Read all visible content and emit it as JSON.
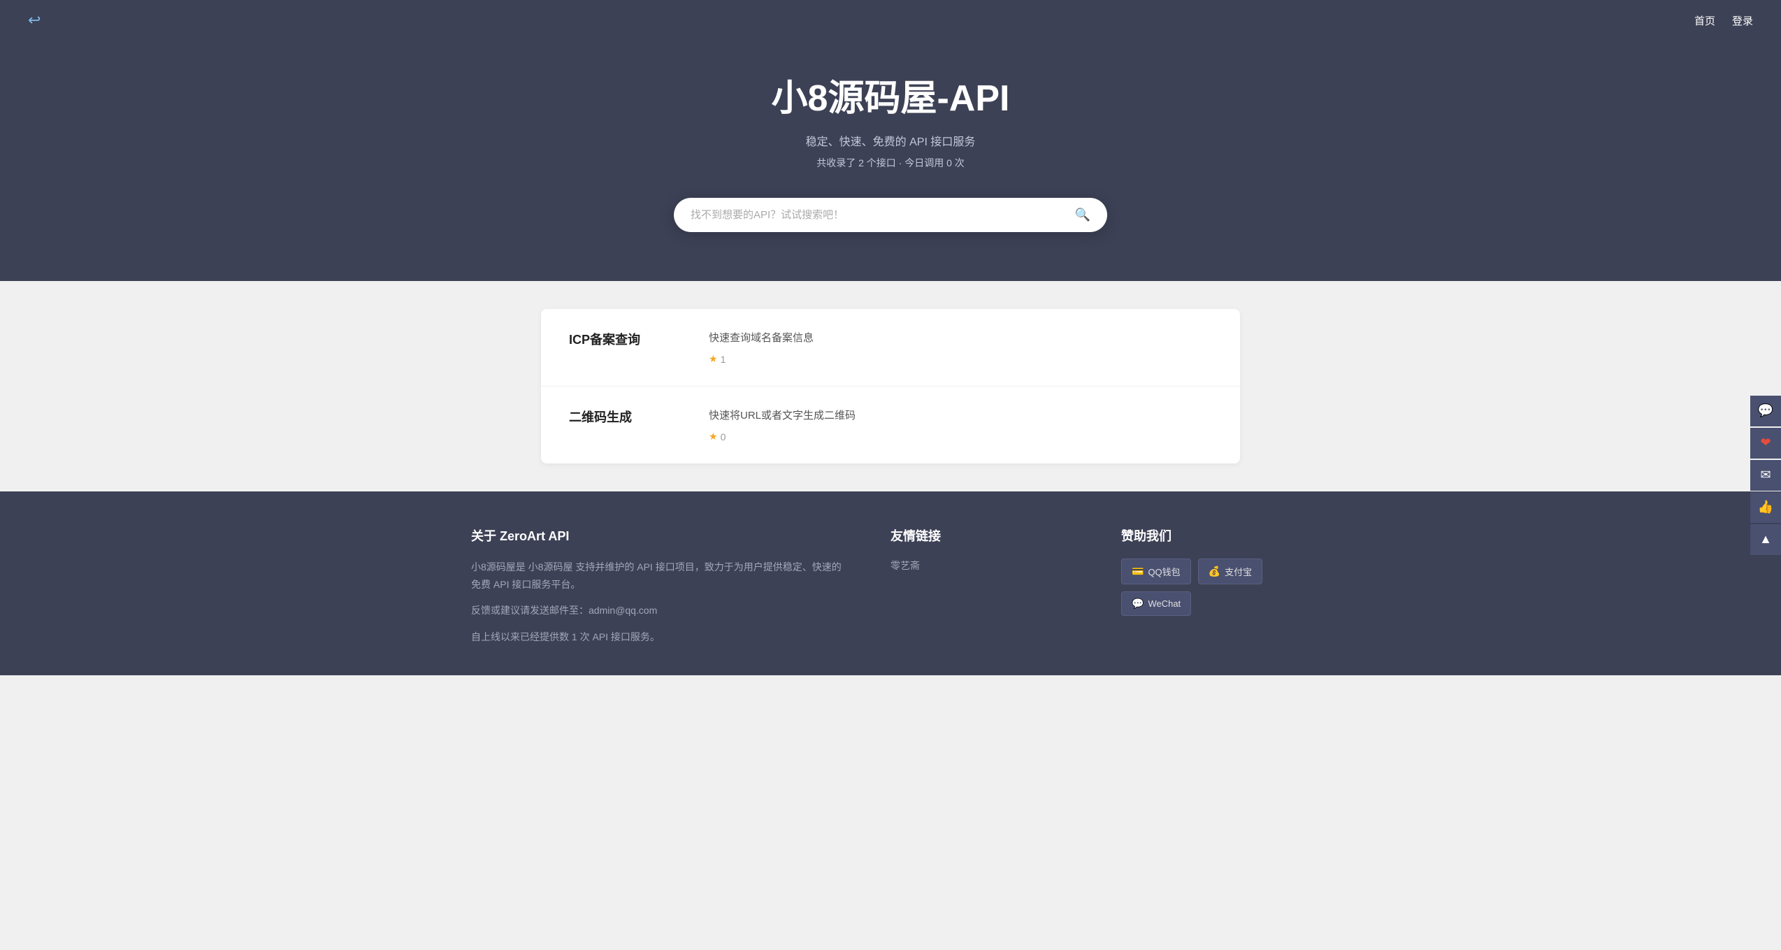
{
  "nav": {
    "logo_icon": "↩",
    "links": [
      {
        "label": "首页",
        "name": "home-link"
      },
      {
        "label": "登录",
        "name": "login-link"
      }
    ]
  },
  "hero": {
    "title": "小8源码屋-API",
    "subtitle": "稳定、快速、免费的 API 接口服务",
    "stats": "共收录了 2 个接口 · 今日调用 0 次",
    "stats_count": "2",
    "stats_today": "0",
    "search_placeholder": "找不到想要的API？试试搜索吧！"
  },
  "api_list": [
    {
      "name": "ICP备案查询",
      "desc": "快速查询域名备案信息",
      "rating": "1"
    },
    {
      "name": "二维码生成",
      "desc": "快速将URL或者文字生成二维码",
      "rating": "0"
    }
  ],
  "footer": {
    "about_title": "关于 ZeroArt API",
    "about_text1": "小8源码屋是 小8源码屋 支持并维护的 API 接口项目，致力于为用户提供稳定、快速的免费 API 接口服务平台。",
    "about_text2": "反馈或建议请发送邮件至：admin@qq.com",
    "about_text3": "自上线以来已经提供数 1 次 API 接口服务。",
    "about_text3_highlight": "1",
    "links_title": "友情链接",
    "links": [
      {
        "label": "零艺斋",
        "name": "friend-link-1"
      }
    ],
    "donate_title": "赞助我们",
    "donate_buttons": [
      {
        "label": "QQ钱包",
        "icon": "💳",
        "name": "qq-pay-btn"
      },
      {
        "label": "支付宝",
        "icon": "💰",
        "name": "alipay-btn"
      },
      {
        "label": "WeChat",
        "icon": "💬",
        "name": "wechat-btn"
      }
    ]
  },
  "float_buttons": [
    {
      "icon": "💬",
      "name": "chat-float-btn",
      "label": "chat"
    },
    {
      "icon": "❤",
      "name": "heart-float-btn",
      "label": "favorite"
    },
    {
      "icon": "✉",
      "name": "message-float-btn",
      "label": "message"
    },
    {
      "icon": "👍",
      "name": "like-float-btn",
      "label": "like"
    },
    {
      "icon": "▲",
      "name": "top-float-btn",
      "label": "back-to-top"
    }
  ]
}
